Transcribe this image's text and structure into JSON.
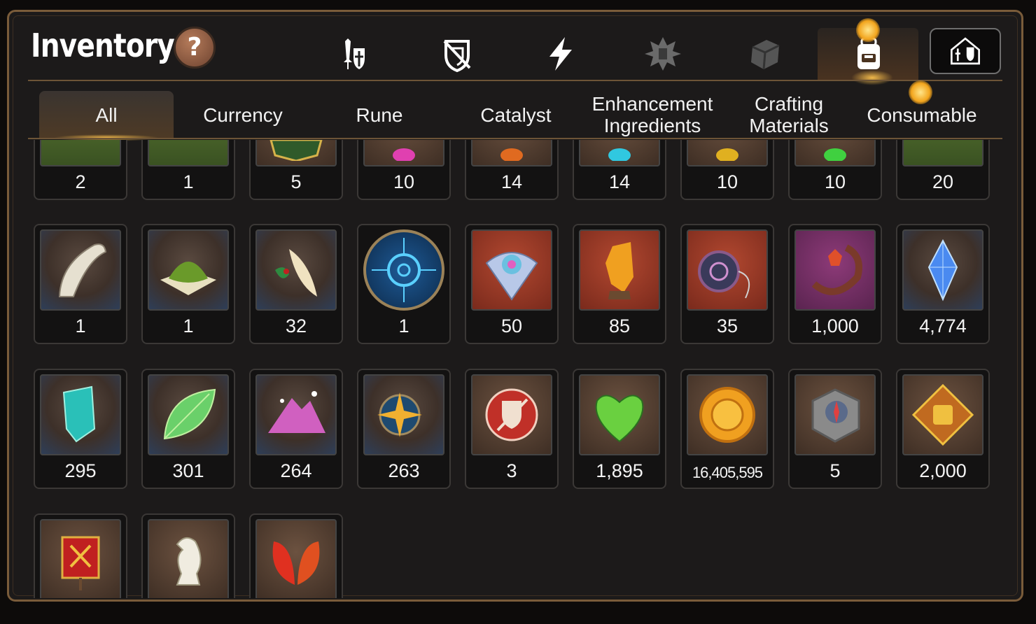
{
  "header": {
    "title": "Inventory",
    "help_label": "?",
    "top_icons": [
      "sword-shield-icon",
      "broken-shield-icon",
      "lightning-icon",
      "beast-emblem-icon",
      "stone-cube-icon",
      "backpack-icon",
      "guild-house-icon"
    ],
    "active_top_icon": "backpack-icon"
  },
  "tabs": [
    {
      "label": "All",
      "active": true
    },
    {
      "label": "Currency",
      "active": false
    },
    {
      "label": "Rune",
      "active": false
    },
    {
      "label": "Catalyst",
      "active": false
    },
    {
      "label": "Enhancement\nIngredients",
      "active": false
    },
    {
      "label": "Crafting\nMaterials",
      "active": false
    },
    {
      "label": "Consumable",
      "active": false
    }
  ],
  "items_row1_partial": [
    "2",
    "1",
    "5",
    "10",
    "14",
    "14",
    "10",
    "10",
    "20"
  ],
  "items_row2": [
    "1",
    "1",
    "32",
    "1",
    "50",
    "85",
    "35",
    "1,000",
    "4,774"
  ],
  "items_row3": [
    "295",
    "301",
    "264",
    "263",
    "3",
    "1,895",
    "16,405,595",
    "5",
    "2,000"
  ],
  "items_row4_partial": [
    "",
    "",
    ""
  ],
  "colors": {
    "accent_gold": "#f0b84a",
    "frame_brown": "#7a5c3a",
    "panel_bg": "#1c1a1a"
  }
}
